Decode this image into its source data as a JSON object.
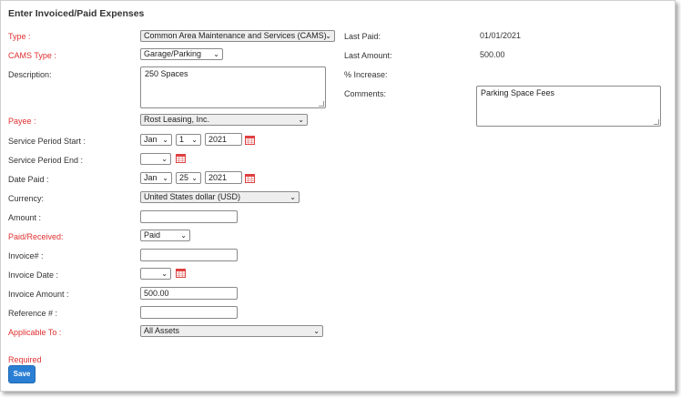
{
  "title": "Enter Invoiced/Paid Expenses",
  "form": {
    "type_label": "Type :",
    "type_value": "Common Area Maintenance and Services (CAMS)",
    "cams_type_label": "CAMS Type :",
    "cams_type_value": "Garage/Parking",
    "description_label": "Description:",
    "description_value": "250 Spaces",
    "payee_label": "Payee :",
    "payee_value": "Rost Leasing, Inc.",
    "service_start_label": "Service Period Start :",
    "service_start_month": "Jan",
    "service_start_day": "1",
    "service_start_year": "2021",
    "service_end_label": "Service Period End :",
    "service_end_value": "",
    "date_paid_label": "Date Paid :",
    "date_paid_month": "Jan",
    "date_paid_day": "25",
    "date_paid_year": "2021",
    "currency_label": "Currency:",
    "currency_value": "United States dollar (USD)",
    "amount_label": "Amount :",
    "amount_value": "",
    "paid_received_label": "Paid/Received:",
    "paid_received_value": "Paid",
    "invoice_no_label": "Invoice# :",
    "invoice_no_value": "",
    "invoice_date_label": "Invoice Date :",
    "invoice_date_value": "",
    "invoice_amount_label": "Invoice Amount :",
    "invoice_amount_value": "500.00",
    "reference_label": "Reference # :",
    "reference_value": "",
    "applicable_to_label": "Applicable To :",
    "applicable_to_value": "All Assets"
  },
  "info": {
    "last_paid_label": "Last Paid:",
    "last_paid_value": "01/01/2021",
    "last_amount_label": "Last Amount:",
    "last_amount_value": "500.00",
    "pct_increase_label": "% Increase:",
    "comments_label": "Comments:",
    "comments_value": "Parking Space Fees"
  },
  "required_text": "Required",
  "save_label": "Save",
  "icons": {
    "dropdown": "chevron-down-icon",
    "calendar": "calendar-icon"
  },
  "colors": {
    "required": "#e03030",
    "button": "#2a7fd4",
    "calendar": "#e04040"
  }
}
